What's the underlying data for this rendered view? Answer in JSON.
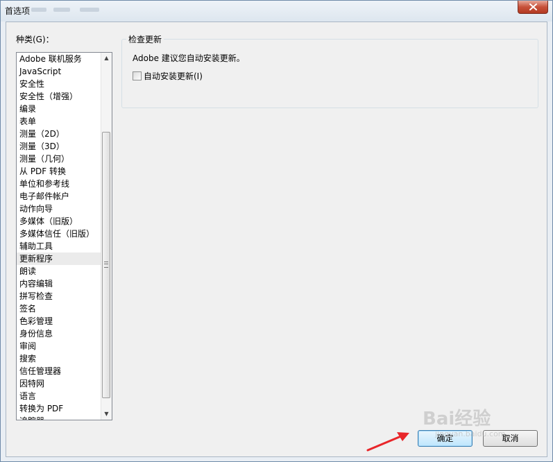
{
  "window": {
    "title": "首选项"
  },
  "categories": {
    "label": "种类(G)：",
    "items": [
      "Adobe 联机服务",
      "JavaScript",
      "安全性",
      "安全性（增强）",
      "编录",
      "表单",
      "测量（2D）",
      "测量（3D）",
      "测量（几何）",
      "从 PDF 转换",
      "单位和参考线",
      "电子邮件帐户",
      "动作向导",
      "多媒体（旧版）",
      "多媒体信任（旧版）",
      "辅助工具",
      "更新程序",
      "朗读",
      "内容编辑",
      "拼写检查",
      "签名",
      "色彩管理",
      "身份信息",
      "审阅",
      "搜索",
      "信任管理器",
      "因特网",
      "语言",
      "转换为 PDF",
      "追踪器"
    ],
    "selected_index": 16
  },
  "updater": {
    "group_title": "检查更新",
    "description": "Adobe 建议您自动安装更新。",
    "auto_install_label": "自动安装更新(I)",
    "auto_install_checked": false
  },
  "buttons": {
    "ok_label": "确定",
    "cancel_label": "取消"
  },
  "watermark": {
    "brand": "Bai经验",
    "site": "jingyan.baidu.com"
  },
  "colors": {
    "annotation_arrow": "#e8262a",
    "default_button": "#bee6fd",
    "close_button": "#c7503a"
  }
}
